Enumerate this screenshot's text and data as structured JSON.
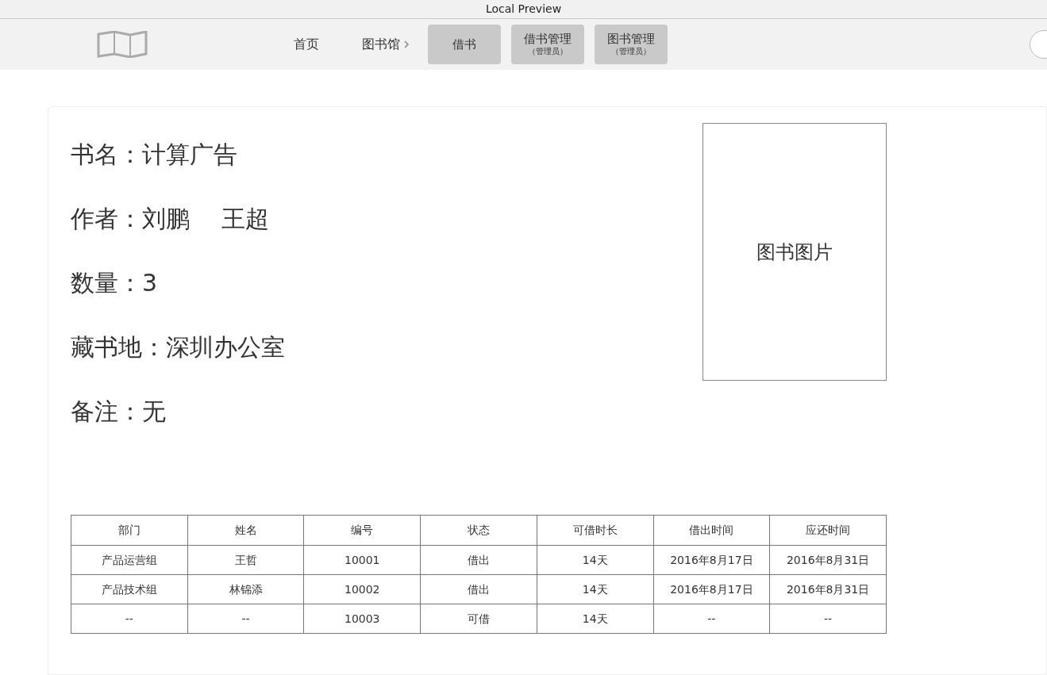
{
  "window": {
    "title": "Local Preview"
  },
  "nav": [
    {
      "kind": "link",
      "label": "首页"
    },
    {
      "kind": "crumb",
      "label": "图书馆"
    },
    {
      "kind": "button",
      "label": "借书"
    },
    {
      "kind": "button",
      "label": "借书管理",
      "sub": "（管理员）"
    },
    {
      "kind": "button",
      "label": "图书管理",
      "sub": "（管理员）"
    }
  ],
  "book": {
    "fields": [
      "书名：计算广告",
      "作者：刘鹏　 王超",
      "数量：3",
      "藏书地：深圳办公室",
      "备注：无"
    ],
    "image_label": "图书图片"
  },
  "table": {
    "columns": [
      "部门",
      "姓名",
      "编号",
      "状态",
      "可借时长",
      "借出时间",
      "应还时间"
    ],
    "rows": [
      [
        "产品运营组",
        "王哲",
        "10001",
        "借出",
        "14天",
        "2016年8月17日",
        "2016年8月31日"
      ],
      [
        "产品技术组",
        "林锦添",
        "10002",
        "借出",
        "14天",
        "2016年8月17日",
        "2016年8月31日"
      ],
      [
        "--",
        "--",
        "10003",
        "可借",
        "14天",
        "--",
        "--"
      ]
    ]
  }
}
